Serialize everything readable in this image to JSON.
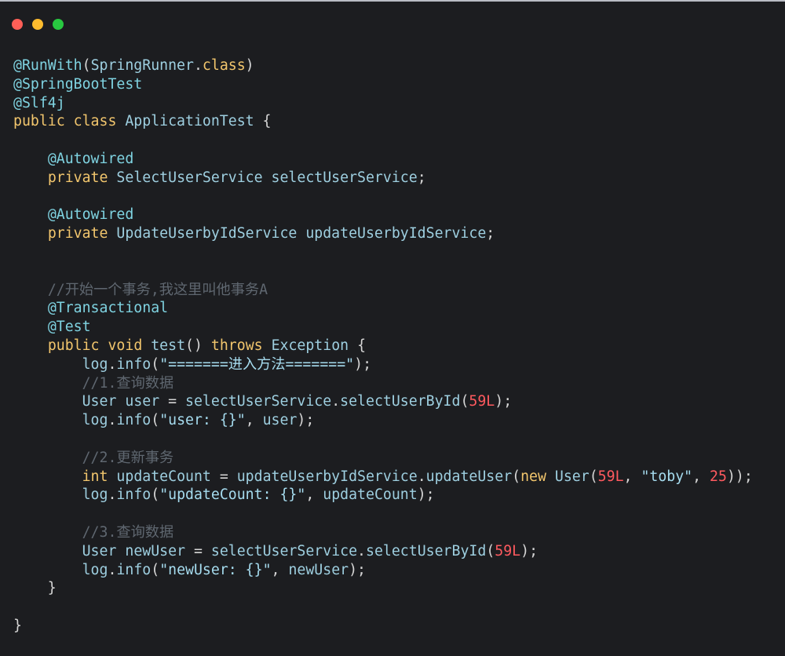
{
  "window": {
    "controls": [
      "close",
      "minimize",
      "maximize"
    ],
    "colors": {
      "background": "#1c1d20",
      "red": "#ff5f57",
      "yellow": "#febc2e",
      "green": "#28c840"
    }
  },
  "code": {
    "language": "java",
    "lines": [
      [
        {
          "t": "@RunWith",
          "c": "ann"
        },
        {
          "t": "(",
          "c": "plain"
        },
        {
          "t": "SpringRunner",
          "c": "type"
        },
        {
          "t": ".",
          "c": "plain"
        },
        {
          "t": "class",
          "c": "kw"
        },
        {
          "t": ")",
          "c": "plain"
        }
      ],
      [
        {
          "t": "@SpringBootTest",
          "c": "ann"
        }
      ],
      [
        {
          "t": "@Slf4j",
          "c": "ann"
        }
      ],
      [
        {
          "t": "public",
          "c": "kw"
        },
        {
          "t": " ",
          "c": "plain"
        },
        {
          "t": "class",
          "c": "kw"
        },
        {
          "t": " ",
          "c": "plain"
        },
        {
          "t": "ApplicationTest",
          "c": "type"
        },
        {
          "t": " {",
          "c": "plain"
        }
      ],
      [],
      [
        {
          "t": "    ",
          "c": "plain"
        },
        {
          "t": "@Autowired",
          "c": "ann"
        }
      ],
      [
        {
          "t": "    ",
          "c": "plain"
        },
        {
          "t": "private",
          "c": "kw"
        },
        {
          "t": " ",
          "c": "plain"
        },
        {
          "t": "SelectUserService",
          "c": "type"
        },
        {
          "t": " selectUserService",
          "c": "ident"
        },
        {
          "t": ";",
          "c": "plain"
        }
      ],
      [],
      [
        {
          "t": "    ",
          "c": "plain"
        },
        {
          "t": "@Autowired",
          "c": "ann"
        }
      ],
      [
        {
          "t": "    ",
          "c": "plain"
        },
        {
          "t": "private",
          "c": "kw"
        },
        {
          "t": " ",
          "c": "plain"
        },
        {
          "t": "UpdateUserbyIdService",
          "c": "type"
        },
        {
          "t": " updateUserbyIdService",
          "c": "ident"
        },
        {
          "t": ";",
          "c": "plain"
        }
      ],
      [],
      [],
      [
        {
          "t": "    ",
          "c": "plain"
        },
        {
          "t": "//开始一个事务,我这里叫他事务A",
          "c": "cmt"
        }
      ],
      [
        {
          "t": "    ",
          "c": "plain"
        },
        {
          "t": "@Transactional",
          "c": "ann"
        }
      ],
      [
        {
          "t": "    ",
          "c": "plain"
        },
        {
          "t": "@Test",
          "c": "ann"
        }
      ],
      [
        {
          "t": "    ",
          "c": "plain"
        },
        {
          "t": "public",
          "c": "kw"
        },
        {
          "t": " ",
          "c": "plain"
        },
        {
          "t": "void",
          "c": "kw"
        },
        {
          "t": " ",
          "c": "plain"
        },
        {
          "t": "test",
          "c": "fn"
        },
        {
          "t": "() ",
          "c": "plain"
        },
        {
          "t": "throws",
          "c": "kw"
        },
        {
          "t": " ",
          "c": "plain"
        },
        {
          "t": "Exception",
          "c": "type"
        },
        {
          "t": " {",
          "c": "plain"
        }
      ],
      [
        {
          "t": "        ",
          "c": "plain"
        },
        {
          "t": "log",
          "c": "ident"
        },
        {
          "t": ".",
          "c": "plain"
        },
        {
          "t": "info",
          "c": "fn"
        },
        {
          "t": "(",
          "c": "plain"
        },
        {
          "t": "\"=======进入方法=======\"",
          "c": "str"
        },
        {
          "t": ");",
          "c": "plain"
        }
      ],
      [
        {
          "t": "        ",
          "c": "plain"
        },
        {
          "t": "//1.查询数据",
          "c": "cmt"
        }
      ],
      [
        {
          "t": "        ",
          "c": "plain"
        },
        {
          "t": "User",
          "c": "type"
        },
        {
          "t": " user ",
          "c": "ident"
        },
        {
          "t": "= ",
          "c": "plain"
        },
        {
          "t": "selectUserService",
          "c": "ident"
        },
        {
          "t": ".",
          "c": "plain"
        },
        {
          "t": "selectUserById",
          "c": "fn"
        },
        {
          "t": "(",
          "c": "plain"
        },
        {
          "t": "59L",
          "c": "num"
        },
        {
          "t": ");",
          "c": "plain"
        }
      ],
      [
        {
          "t": "        ",
          "c": "plain"
        },
        {
          "t": "log",
          "c": "ident"
        },
        {
          "t": ".",
          "c": "plain"
        },
        {
          "t": "info",
          "c": "fn"
        },
        {
          "t": "(",
          "c": "plain"
        },
        {
          "t": "\"user: {}\"",
          "c": "str"
        },
        {
          "t": ", ",
          "c": "plain"
        },
        {
          "t": "user",
          "c": "ident"
        },
        {
          "t": ");",
          "c": "plain"
        }
      ],
      [],
      [
        {
          "t": "        ",
          "c": "plain"
        },
        {
          "t": "//2.更新事务",
          "c": "cmt"
        }
      ],
      [
        {
          "t": "        ",
          "c": "plain"
        },
        {
          "t": "int",
          "c": "kw"
        },
        {
          "t": " updateCount ",
          "c": "ident"
        },
        {
          "t": "= ",
          "c": "plain"
        },
        {
          "t": "updateUserbyIdService",
          "c": "ident"
        },
        {
          "t": ".",
          "c": "plain"
        },
        {
          "t": "updateUser",
          "c": "fn"
        },
        {
          "t": "(",
          "c": "plain"
        },
        {
          "t": "new",
          "c": "kw"
        },
        {
          "t": " ",
          "c": "plain"
        },
        {
          "t": "User",
          "c": "type"
        },
        {
          "t": "(",
          "c": "plain"
        },
        {
          "t": "59L",
          "c": "num"
        },
        {
          "t": ", ",
          "c": "plain"
        },
        {
          "t": "\"toby\"",
          "c": "str"
        },
        {
          "t": ", ",
          "c": "plain"
        },
        {
          "t": "25",
          "c": "num"
        },
        {
          "t": "));",
          "c": "plain"
        }
      ],
      [
        {
          "t": "        ",
          "c": "plain"
        },
        {
          "t": "log",
          "c": "ident"
        },
        {
          "t": ".",
          "c": "plain"
        },
        {
          "t": "info",
          "c": "fn"
        },
        {
          "t": "(",
          "c": "plain"
        },
        {
          "t": "\"updateCount: {}\"",
          "c": "str"
        },
        {
          "t": ", ",
          "c": "plain"
        },
        {
          "t": "updateCount",
          "c": "ident"
        },
        {
          "t": ");",
          "c": "plain"
        }
      ],
      [],
      [
        {
          "t": "        ",
          "c": "plain"
        },
        {
          "t": "//3.查询数据",
          "c": "cmt"
        }
      ],
      [
        {
          "t": "        ",
          "c": "plain"
        },
        {
          "t": "User",
          "c": "type"
        },
        {
          "t": " newUser ",
          "c": "ident"
        },
        {
          "t": "= ",
          "c": "plain"
        },
        {
          "t": "selectUserService",
          "c": "ident"
        },
        {
          "t": ".",
          "c": "plain"
        },
        {
          "t": "selectUserById",
          "c": "fn"
        },
        {
          "t": "(",
          "c": "plain"
        },
        {
          "t": "59L",
          "c": "num"
        },
        {
          "t": ");",
          "c": "plain"
        }
      ],
      [
        {
          "t": "        ",
          "c": "plain"
        },
        {
          "t": "log",
          "c": "ident"
        },
        {
          "t": ".",
          "c": "plain"
        },
        {
          "t": "info",
          "c": "fn"
        },
        {
          "t": "(",
          "c": "plain"
        },
        {
          "t": "\"newUser: {}\"",
          "c": "str"
        },
        {
          "t": ", ",
          "c": "plain"
        },
        {
          "t": "newUser",
          "c": "ident"
        },
        {
          "t": ");",
          "c": "plain"
        }
      ],
      [
        {
          "t": "    }",
          "c": "plain"
        }
      ],
      [],
      [
        {
          "t": "}",
          "c": "plain"
        }
      ]
    ]
  }
}
